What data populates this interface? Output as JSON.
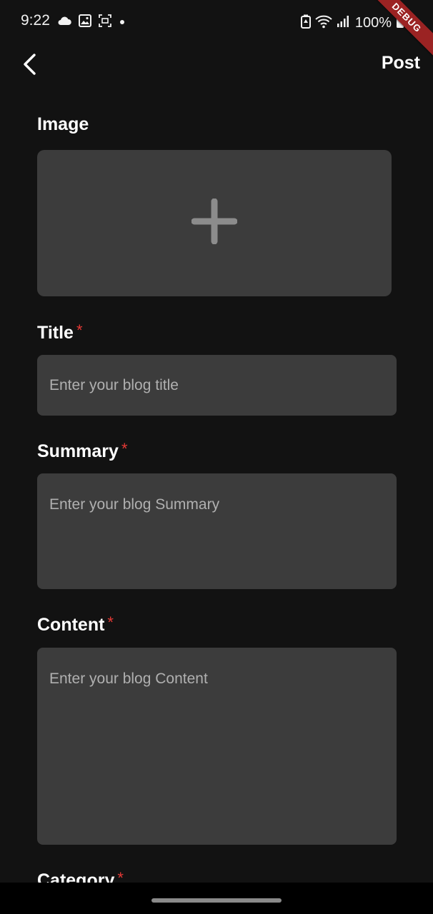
{
  "status_bar": {
    "time": "9:22",
    "battery": "100%",
    "left_icons": [
      "cloud-icon",
      "image-icon",
      "screenshot-icon",
      "dot-icon"
    ],
    "right_icons": [
      "battery-saver-icon",
      "wifi-icon",
      "signal-icon",
      "battery-icon"
    ]
  },
  "debug_banner": "DEBUG",
  "app_bar": {
    "back_icon": "chevron-left-icon",
    "post_label": "Post"
  },
  "form": {
    "image": {
      "label": "Image",
      "add_icon": "plus-icon"
    },
    "title": {
      "label": "Title",
      "required_mark": "*",
      "placeholder": "Enter your blog title"
    },
    "summary": {
      "label": "Summary",
      "required_mark": "*",
      "placeholder": "Enter your blog Summary"
    },
    "content": {
      "label": "Content",
      "required_mark": "*",
      "placeholder": "Enter your blog Content"
    },
    "category": {
      "label": "Category",
      "required_mark": "*"
    }
  },
  "colors": {
    "background": "#121212",
    "field_background": "#3c3c3c",
    "required": "#e53935",
    "placeholder": "#b0b0b0"
  }
}
